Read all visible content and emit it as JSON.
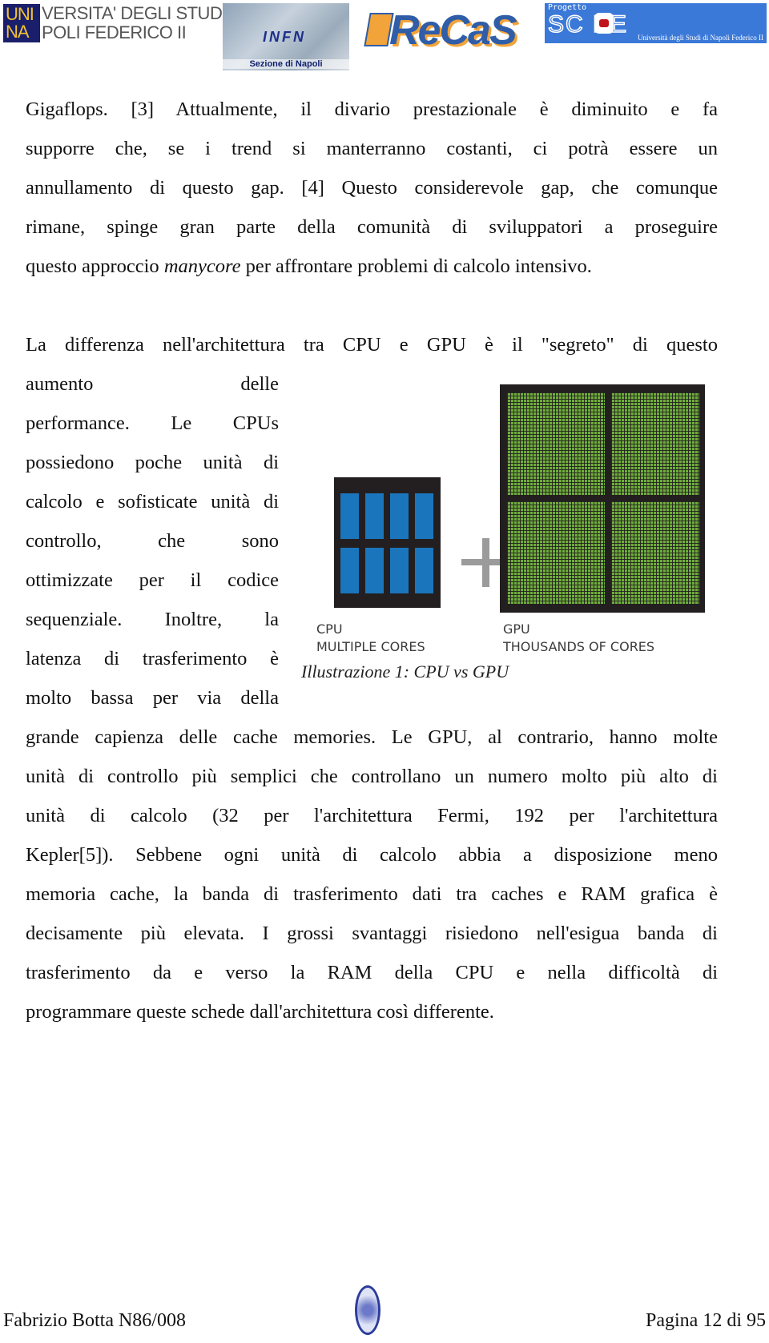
{
  "header": {
    "logos": {
      "unina": {
        "box_line1": "UNI",
        "box_line2": "NA",
        "text_line1": "VERSITA' DEGLI STUDI DI",
        "text_line2": "POLI FEDERICO II"
      },
      "infn": {
        "title": "INFN",
        "subtitle": "Sezione di Napoli"
      },
      "recas": {
        "title": "ReCaS"
      },
      "scope": {
        "prefix": "Progetto",
        "title": "SC PE",
        "subtitle": "Università degli Studi di Napoli Federico II"
      }
    }
  },
  "paragraph1": {
    "lines": [
      "Gigaflops. [3] Attualmente, il divario prestazionale è diminuito e fa",
      "supporre che, se i trend si manterranno costanti, ci potrà essere un",
      "annullamento di questo gap. [4] Questo considerevole gap, che comunque",
      "rimane, spinge gran parte della comunità di sviluppatori a proseguire"
    ],
    "last_line_before": "questo approccio ",
    "last_line_em": "manycore",
    "last_line_after": " per affrontare problemi di calcolo intensivo."
  },
  "paragraph2": {
    "first_line": "La differenza nell'architettura tra CPU e GPU è il \"segreto\" di questo",
    "narrow_lines": [
      "aumento delle",
      "performance. Le CPUs",
      "possiedono poche unità di",
      "calcolo e sofisticate unità di",
      "controllo, che sono",
      "ottimizzate per il codice",
      "sequenziale. Inoltre, la",
      "latenza di trasferimento è",
      "molto bassa per via della"
    ],
    "wide_lines": [
      "grande capienza delle cache memories. Le GPU, al contrario, hanno molte",
      "unità di controllo più semplici che controllano un numero molto più alto di",
      "unità di calcolo (32 per l'architettura Fermi, 192 per l'architettura",
      "Kepler[5]). Sebbene ogni unità di calcolo abbia a disposizione meno",
      "memoria cache, la banda di trasferimento dati tra caches e RAM grafica è",
      "decisamente più elevata. I grossi svantaggi risiedono nell'esigua banda di",
      "trasferimento da e verso la RAM della CPU e nella difficoltà di",
      "programmare queste schede dall'architettura così differente."
    ]
  },
  "figure": {
    "cpu_label_1": "CPU",
    "cpu_label_2": "MULTIPLE CORES",
    "gpu_label_1": "GPU",
    "gpu_label_2": "THOUSANDS OF CORES",
    "caption": "Illustrazione 1: CPU vs GPU",
    "cpu_cores": 8,
    "colors": {
      "cpu_core": "#1b75bc",
      "gpu_core": "#6fae3c",
      "chip": "#231f20",
      "plus": "#9b9b9b"
    }
  },
  "footer": {
    "author": "Fabrizio Botta N86/008",
    "page": "Pagina 12 di 95"
  }
}
